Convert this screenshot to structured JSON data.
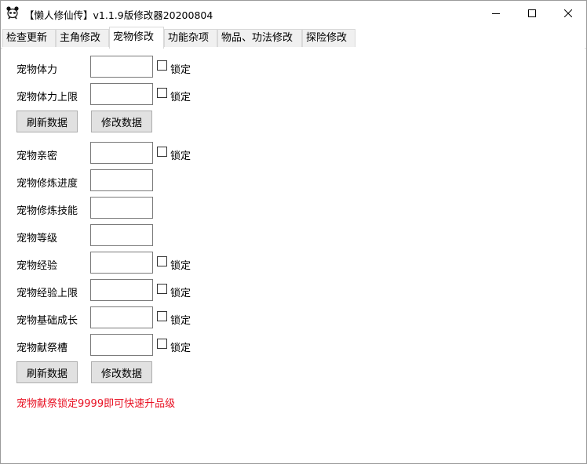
{
  "window": {
    "title": "【懒人修仙传】v1.1.9版修改器20200804",
    "icon": "panda-icon",
    "controls": [
      "minimize-icon",
      "maximize-icon",
      "close-icon"
    ]
  },
  "tabs": [
    {
      "label": "检查更新",
      "active": false
    },
    {
      "label": "主角修改",
      "active": false
    },
    {
      "label": "宠物修改",
      "active": true
    },
    {
      "label": "功能杂项",
      "active": false
    },
    {
      "label": "物品、功法修改",
      "active": false
    },
    {
      "label": "探险修改",
      "active": false
    }
  ],
  "group1": {
    "fields": [
      {
        "label": "宠物体力",
        "value": "",
        "lock": true,
        "lock_label": "锁定"
      },
      {
        "label": "宠物体力上限",
        "value": "",
        "lock": true,
        "lock_label": "锁定"
      }
    ],
    "refresh_label": "刷新数据",
    "modify_label": "修改数据"
  },
  "group2": {
    "fields": [
      {
        "label": "宠物亲密",
        "value": "",
        "lock": true,
        "lock_label": "锁定"
      },
      {
        "label": "宠物修炼进度",
        "value": "",
        "lock": false
      },
      {
        "label": "宠物修炼技能",
        "value": "",
        "lock": false
      },
      {
        "label": "宠物等级",
        "value": "",
        "lock": false
      },
      {
        "label": "宠物经验",
        "value": "",
        "lock": true,
        "lock_label": "锁定"
      },
      {
        "label": "宠物经验上限",
        "value": "",
        "lock": true,
        "lock_label": "锁定"
      },
      {
        "label": "宠物基础成长",
        "value": "",
        "lock": true,
        "lock_label": "锁定"
      },
      {
        "label": "宠物献祭槽",
        "value": "",
        "lock": true,
        "lock_label": "锁定"
      }
    ],
    "refresh_label": "刷新数据",
    "modify_label": "修改数据"
  },
  "note": "宠物献祭锁定9999即可快速升品级",
  "colors": {
    "note": "#e81123",
    "button_bg": "#e1e1e1",
    "tab_bg": "#f0f0f0"
  }
}
